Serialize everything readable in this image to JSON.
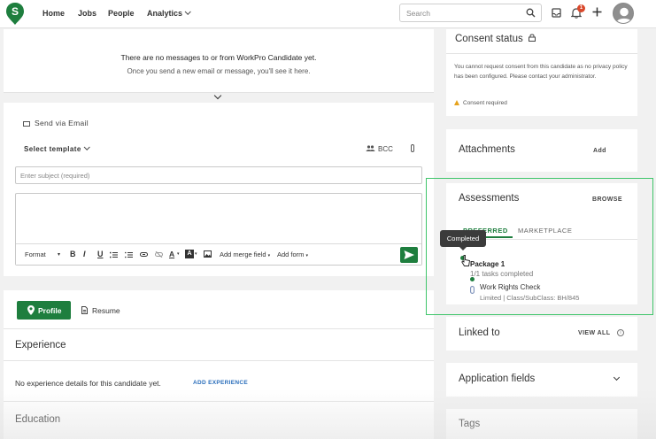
{
  "nav": {
    "home": "Home",
    "jobs": "Jobs",
    "people": "People",
    "analytics": "Analytics",
    "search_placeholder": "Search",
    "notification_count": "1"
  },
  "messages": {
    "empty_title": "There are no messages to or from WorkPro Candidate yet.",
    "empty_sub": "Once you send a new email or message, you'll see it here."
  },
  "email": {
    "send_via": "Send via Email",
    "select_template": "Select template",
    "bcc": "BCC",
    "subject_placeholder": "Enter subject (required)",
    "toolbar": {
      "format": "Format",
      "bold": "B",
      "italic": "I",
      "underline": "U",
      "merge_field": "Add merge field",
      "add_form": "Add form"
    }
  },
  "profile": {
    "profile_tab": "Profile",
    "resume_tab": "Resume",
    "experience_title": "Experience",
    "no_experience": "No experience details for this candidate yet.",
    "add_experience": "ADD EXPERIENCE",
    "education_title": "Education"
  },
  "consent": {
    "title": "Consent status",
    "text": "You cannot request consent from this candidate as no privacy policy has been configured. Please contact your administrator.",
    "required": "Consent required"
  },
  "attachments": {
    "title": "Attachments",
    "add": "Add"
  },
  "assessments": {
    "title": "Assessments",
    "browse": "BROWSE",
    "tab_preferred": "PREFERRED",
    "tab_marketplace": "MARKETPLACE",
    "tooltip": "Completed",
    "package_name": "Package 1",
    "package_tasks": "1/1 tasks completed",
    "item_name": "Work Rights Check",
    "item_sub": "Limited | Class/SubClass: BH/845"
  },
  "linked_to": {
    "title": "Linked to",
    "view_all": "VIEW ALL"
  },
  "application_fields": {
    "title": "Application fields"
  },
  "tags": {
    "title": "Tags"
  },
  "colors": {
    "brand_green": "#1e7e3e",
    "highlight_green": "#3fc56a",
    "link_blue": "#2a6ebb",
    "badge_red": "#d9482b"
  }
}
